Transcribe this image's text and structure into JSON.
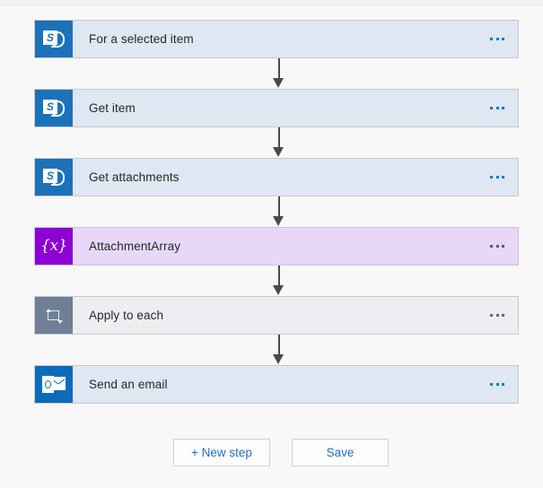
{
  "theme": {
    "background": "#f8f8f8",
    "card_blue_bg": "#dee7f2",
    "card_purple_bg": "#e7d8f7",
    "card_gray_bg": "#eceef1",
    "sharepoint_blue": "#1b72bb",
    "outlook_blue": "#0a6cbb",
    "variable_purple": "#8d00d4",
    "loop_gray": "#6f8096",
    "link_blue": "#1f6fd0",
    "arrow_gray": "#4a4a4a",
    "border_gray": "#c8c8c8"
  },
  "flow": {
    "steps": [
      {
        "label": "For a selected item",
        "icon": "sharepoint-icon",
        "type": "connector",
        "menu_label": "..."
      },
      {
        "label": "Get item",
        "icon": "sharepoint-icon",
        "type": "connector",
        "menu_label": "..."
      },
      {
        "label": "Get attachments",
        "icon": "sharepoint-icon",
        "type": "connector",
        "menu_label": "..."
      },
      {
        "label": "AttachmentArray",
        "icon": "variable-icon",
        "type": "variable",
        "menu_label": "..."
      },
      {
        "label": "Apply to each",
        "icon": "loop-icon",
        "type": "loop",
        "menu_label": "..."
      },
      {
        "label": "Send an email",
        "icon": "outlook-icon",
        "type": "connector",
        "menu_label": "..."
      }
    ]
  },
  "actions": {
    "new_step_label": "+ New step",
    "save_label": "Save"
  }
}
